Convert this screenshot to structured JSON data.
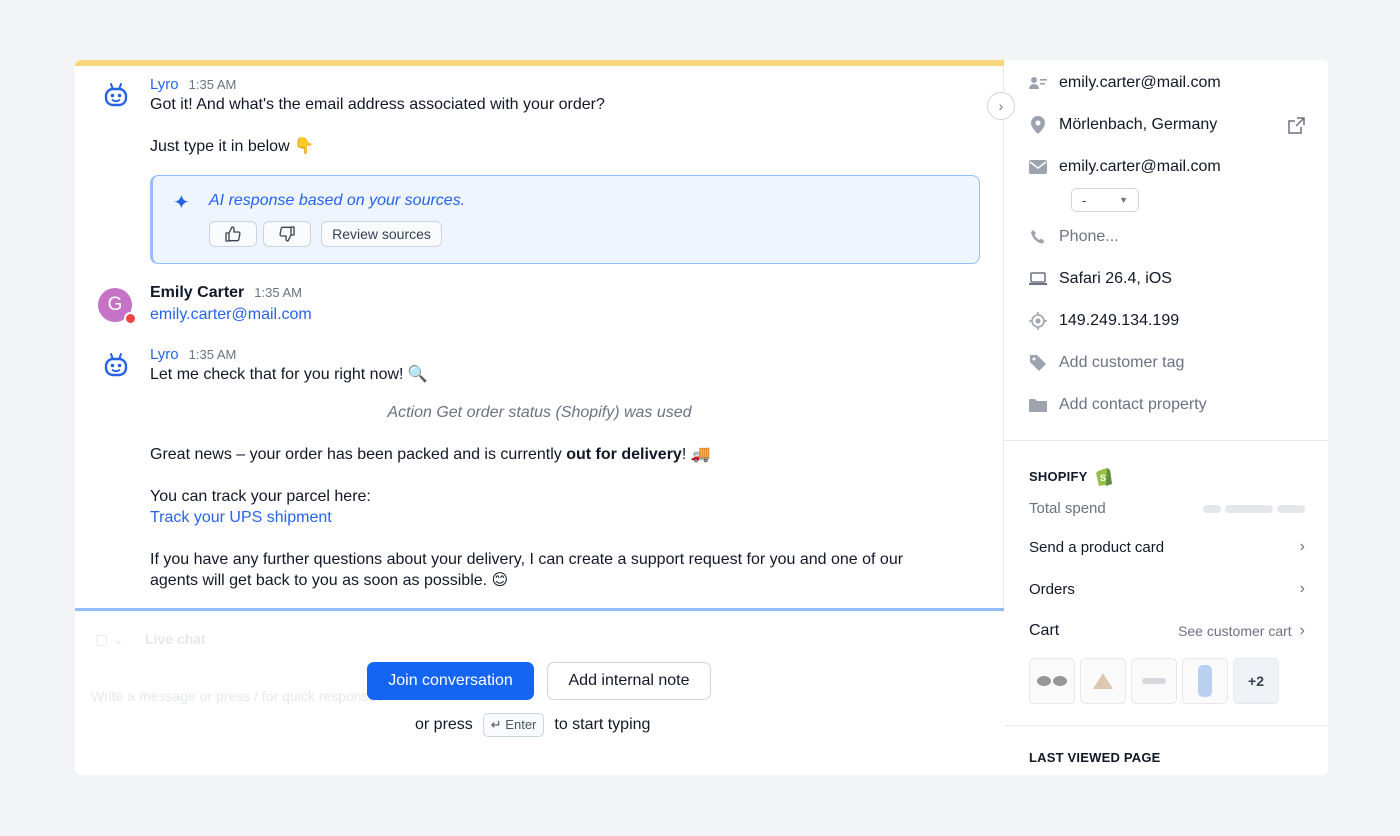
{
  "chat": {
    "messages": [
      {
        "sender": "Lyro",
        "time": "1:35 AM",
        "lines": [
          "Got it! And what's the email address associated with your order?",
          "Just type it in below 👇"
        ],
        "ai_note": "AI response based on your sources.",
        "review_label": "Review sources"
      },
      {
        "sender": "Emily Carter",
        "time": "1:35 AM",
        "avatar_letter": "G",
        "text": "emily.carter@mail.com"
      },
      {
        "sender": "Lyro",
        "time": "1:35 AM",
        "line1": "Let me check that for you right now! 🔍",
        "action": "Action Get order status (Shopify) was used",
        "delivery_pre": "Great news – your order has been packed and is currently ",
        "delivery_bold": "out for delivery",
        "delivery_post": "! 🚚",
        "track_intro": "You can track your parcel here:",
        "track_link": "Track your UPS shipment",
        "further1": "If you have any further questions about your delivery, I can create a support request for you and one of our",
        "further2": "agents will get back to you as soon as possible. 😊"
      }
    ]
  },
  "composer": {
    "channel_label": "Live chat",
    "placeholder": "Write a message or press / for quick responses",
    "join_label": "Join conversation",
    "note_label": "Add internal note",
    "press_prefix": "or press",
    "key_label": "↵ Enter",
    "press_suffix": "to start typing"
  },
  "sidebar": {
    "contact_email": "emily.carter@mail.com",
    "location": "Mörlenbach, Germany",
    "email": "emily.carter@mail.com",
    "email_select": "-",
    "phone_placeholder": "Phone...",
    "browser": "Safari 26.4, iOS",
    "ip": "149.249.134.199",
    "add_tag": "Add customer tag",
    "add_property": "Add contact property",
    "shopify_title": "SHOPIFY",
    "total_spend_label": "Total spend",
    "send_product_card": "Send a product card",
    "orders": "Orders",
    "cart": "Cart",
    "see_cart": "See customer cart",
    "more_items": "+2",
    "last_viewed_title": "LAST VIEWED PAGE"
  },
  "colors": {
    "accent": "#1565f5",
    "bot_name": "#2563eb",
    "top_bar": "#f7d77c",
    "ai_box_border": "#93bdfc",
    "user_avatar": "#c572c7",
    "shopify_green": "#95bf47"
  }
}
